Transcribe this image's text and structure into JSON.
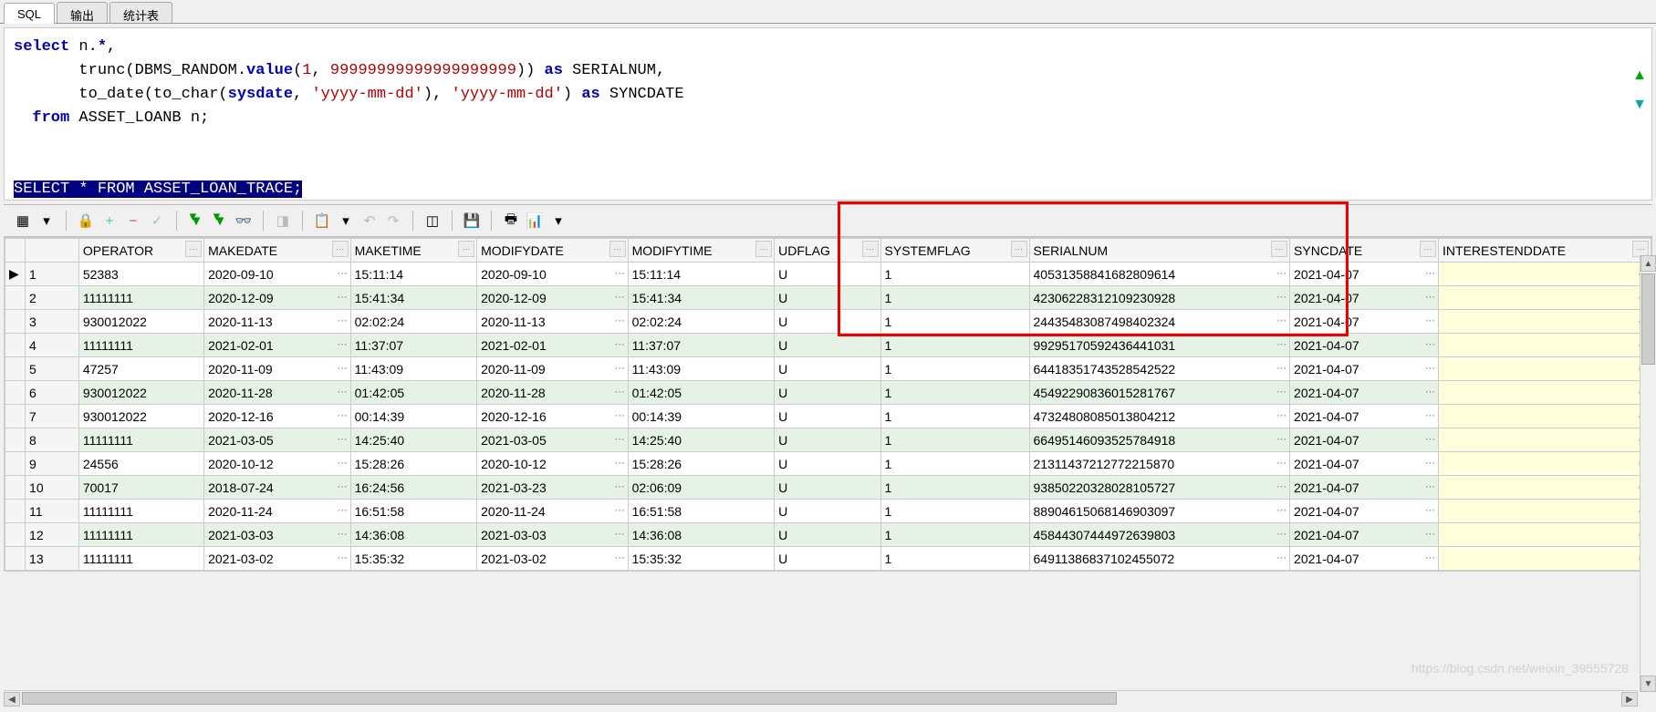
{
  "tabs": [
    "SQL",
    "输出",
    "统计表"
  ],
  "sql_lines": [
    [
      [
        "kw",
        "select"
      ],
      [
        "ident",
        " n."
      ],
      [
        "kw",
        "*"
      ],
      [
        "ident",
        ","
      ]
    ],
    [
      [
        "ident",
        "       trunc(DBMS_RANDOM."
      ],
      [
        "kw",
        "value"
      ],
      [
        "ident",
        "("
      ],
      [
        "num",
        "1"
      ],
      [
        "ident",
        ", "
      ],
      [
        "num",
        "99999999999999999999"
      ],
      [
        "ident",
        ")) "
      ],
      [
        "kw",
        "as"
      ],
      [
        "ident",
        " SERIALNUM,"
      ]
    ],
    [
      [
        "ident",
        "       to_date(to_char("
      ],
      [
        "kw",
        "sysdate"
      ],
      [
        "ident",
        ", "
      ],
      [
        "str",
        "'yyyy-mm-dd'"
      ],
      [
        "ident",
        "), "
      ],
      [
        "str",
        "'yyyy-mm-dd'"
      ],
      [
        "ident",
        ") "
      ],
      [
        "kw",
        "as"
      ],
      [
        "ident",
        " SYNCDATE"
      ]
    ],
    [
      [
        "ident",
        "  "
      ],
      [
        "kw",
        "from"
      ],
      [
        "ident",
        " ASSET_LOANB n;"
      ]
    ]
  ],
  "sql_selected": "SELECT * FROM ASSET_LOAN_TRACE;",
  "columns": [
    "OPERATOR",
    "MAKEDATE",
    "MAKETIME",
    "MODIFYDATE",
    "MODIFYTIME",
    "UDFLAG",
    "SYSTEMFLAG",
    "SERIALNUM",
    "SYNCDATE",
    "INTERESTENDDATE"
  ],
  "col_classes": [
    "col-op",
    "col-make",
    "col-mtime",
    "col-mod",
    "col-mtime2",
    "col-ud",
    "col-sys",
    "col-ser",
    "col-sync",
    "col-int"
  ],
  "ellipsis_cols": [
    1,
    3,
    7,
    8,
    9
  ],
  "rows": [
    [
      "52383",
      "2020-09-10",
      "15:11:14",
      "2020-09-10",
      "15:11:14",
      "U",
      "1",
      "40531358841682809614",
      "2021-04-07",
      ""
    ],
    [
      "11111111",
      "2020-12-09",
      "15:41:34",
      "2020-12-09",
      "15:41:34",
      "U",
      "1",
      "42306228312109230928",
      "2021-04-07",
      ""
    ],
    [
      "930012022",
      "2020-11-13",
      "02:02:24",
      "2020-11-13",
      "02:02:24",
      "U",
      "1",
      "24435483087498402324",
      "2021-04-07",
      ""
    ],
    [
      "11111111",
      "2021-02-01",
      "11:37:07",
      "2021-02-01",
      "11:37:07",
      "U",
      "1",
      "99295170592436441031",
      "2021-04-07",
      ""
    ],
    [
      "47257",
      "2020-11-09",
      "11:43:09",
      "2020-11-09",
      "11:43:09",
      "U",
      "1",
      "64418351743528542522",
      "2021-04-07",
      ""
    ],
    [
      "930012022",
      "2020-11-28",
      "01:42:05",
      "2020-11-28",
      "01:42:05",
      "U",
      "1",
      "45492290836015281767",
      "2021-04-07",
      ""
    ],
    [
      "930012022",
      "2020-12-16",
      "00:14:39",
      "2020-12-16",
      "00:14:39",
      "U",
      "1",
      "47324808085013804212",
      "2021-04-07",
      ""
    ],
    [
      "11111111",
      "2021-03-05",
      "14:25:40",
      "2021-03-05",
      "14:25:40",
      "U",
      "1",
      "66495146093525784918",
      "2021-04-07",
      ""
    ],
    [
      "24556",
      "2020-10-12",
      "15:28:26",
      "2020-10-12",
      "15:28:26",
      "U",
      "1",
      "21311437212772215870",
      "2021-04-07",
      ""
    ],
    [
      "70017",
      "2018-07-24",
      "16:24:56",
      "2021-03-23",
      "02:06:09",
      "U",
      "1",
      "93850220328028105727",
      "2021-04-07",
      ""
    ],
    [
      "11111111",
      "2020-11-24",
      "16:51:58",
      "2020-11-24",
      "16:51:58",
      "U",
      "1",
      "88904615068146903097",
      "2021-04-07",
      ""
    ],
    [
      "11111111",
      "2021-03-03",
      "14:36:08",
      "2021-03-03",
      "14:36:08",
      "U",
      "1",
      "45844307444972639803",
      "2021-04-07",
      ""
    ],
    [
      "11111111",
      "2021-03-02",
      "15:35:32",
      "2021-03-02",
      "15:35:32",
      "U",
      "1",
      "64911386837102455072",
      "2021-04-07",
      ""
    ]
  ],
  "toolbar_icons": [
    {
      "name": "grid-icon",
      "glyph": "▦",
      "cls": ""
    },
    {
      "name": "dropdown-icon",
      "glyph": "▾",
      "cls": ""
    },
    {
      "sep": true
    },
    {
      "name": "lock-icon",
      "glyph": "🔒",
      "cls": ""
    },
    {
      "name": "plus-icon",
      "glyph": "+",
      "cls": "plus dis"
    },
    {
      "name": "minus-icon",
      "glyph": "−",
      "cls": "minus dis"
    },
    {
      "name": "check-icon",
      "glyph": "✓",
      "cls": "check"
    },
    {
      "sep": true
    },
    {
      "name": "fetch-icon",
      "glyph": "▼",
      "cls": "ylw",
      "stack": true
    },
    {
      "name": "fetch-all-icon",
      "glyph": "▼",
      "cls": "ylw",
      "stack": true
    },
    {
      "name": "binoculars-icon",
      "glyph": "👓",
      "cls": ""
    },
    {
      "sep": true
    },
    {
      "name": "eraser-icon",
      "glyph": "◨",
      "cls": "dis"
    },
    {
      "sep": true
    },
    {
      "name": "copy-icon",
      "glyph": "📋",
      "cls": ""
    },
    {
      "name": "clip-drop-icon",
      "glyph": "▾",
      "cls": ""
    },
    {
      "name": "undo-icon",
      "glyph": "↶",
      "cls": "dis"
    },
    {
      "name": "redo-icon",
      "glyph": "↷",
      "cls": "dis"
    },
    {
      "sep": true
    },
    {
      "name": "view-icon",
      "glyph": "◫",
      "cls": ""
    },
    {
      "sep": true
    },
    {
      "name": "save-icon",
      "glyph": "💾",
      "cls": ""
    },
    {
      "sep": true
    },
    {
      "name": "print-icon",
      "glyph": "🖶",
      "cls": ""
    },
    {
      "name": "export-icon",
      "glyph": "📊",
      "cls": ""
    },
    {
      "name": "export-drop-icon",
      "glyph": "▾",
      "cls": ""
    }
  ],
  "watermark": "https://blog.csdn.net/weixin_39555728"
}
